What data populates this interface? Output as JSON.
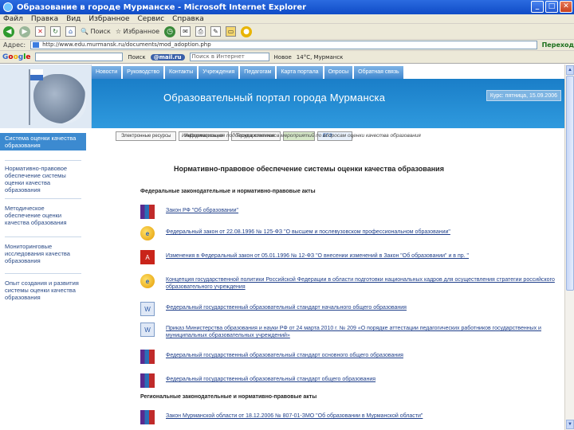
{
  "window": {
    "title": "Образование в городе Мурманске - Microsoft Internet Explorer",
    "buttons": [
      "_",
      "□",
      "✕"
    ]
  },
  "menubar": [
    "Файл",
    "Правка",
    "Вид",
    "Избранное",
    "Сервис",
    "Справка"
  ],
  "toolbar": {
    "back_label": "",
    "search_label": "Поиск",
    "favorites_label": "Избранное"
  },
  "address": {
    "label": "Адрес:",
    "value": "http://www.edu.murmansk.ru/documents/mod_adoption.php",
    "go_label": "Переход"
  },
  "googlebar": {
    "logo": [
      "G",
      "o",
      "o",
      "g",
      "l",
      "e"
    ],
    "go_label": "Поиск",
    "mail_label": "@mail.ru",
    "search_placeholder": "Поиск в Интернет",
    "news_label": "Новое",
    "weather_label": "14°C, Мурманск"
  },
  "nav_tabs": [
    "Новости",
    "Руководство",
    "Контакты",
    "Учреждения",
    "Педагогам",
    "Карта портала",
    "Опросы",
    "Обратная связь"
  ],
  "banner": {
    "title": "Образовательный портал города Мурманска",
    "badge": "Курс: пятница, 15.09.2006"
  },
  "subtabs": [
    "Электронные ресурсы",
    "Информатизация",
    "Государственная",
    "",
    "ЕГЭ"
  ],
  "info_line": "Информационная поддержка комплекса мероприятий по вопросам оценки качества образования",
  "sidebar": [
    "Система оценки качества образования",
    "Нормативно-правовое обеспечение системы оценки качества образования",
    "Методическое обеспечение оценки качества образования",
    "Мониторинговые исследования качества образования",
    "Опыт создания и развития системы оценки качества образования"
  ],
  "content": {
    "title": "Нормативно-правовое обеспечение системы оценки качества образования",
    "section_federal": "Федеральные законодательные и нормативно-правовые акты",
    "section_regional": "Региональные законодательные и нормативно-правовые акты",
    "documents": [
      {
        "icon": "rar",
        "text": "Закон РФ \"Об образовании\""
      },
      {
        "icon": "ie",
        "text": "Федеральный закон от 22.08.1996 № 125-ФЗ \"О высшем и послевузовском профессиональном образовании\""
      },
      {
        "icon": "pdf",
        "text": "Изменения в Федеральный закон от 05.01.1996 № 12-ФЗ \"О внесении изменений в Закон \"Об образовании\" и в пр. \""
      },
      {
        "icon": "ie",
        "text": "Концепция государственной политики Российской Федерации в области подготовки национальных кадров для осуществления стратегии российского образовательного учреждения"
      },
      {
        "icon": "doc",
        "text": "Федеральный государственный образовательный стандарт начального общего образования"
      },
      {
        "icon": "doc",
        "text": "Приказ Министерства образования и науки РФ от 24 марта 2010 г. № 209 «О порядке аттестации педагогических работников государственных и муниципальных образовательных учреждений»"
      },
      {
        "icon": "rar",
        "text": "Федеральный государственный образовательный стандарт основного общего образования"
      },
      {
        "icon": "rar",
        "text": "Федеральный государственный образовательный стандарт общего образования"
      },
      {
        "icon": "rar",
        "text": "Закон Мурманской области от 18.12.2006 № 807-01-ЗМО \"Об образовании в Мурманской области\""
      }
    ]
  },
  "colors": {
    "banner": "#2f9ade",
    "nav_tab": "#3f87cf",
    "sidebar_active": "#3c8ad0",
    "link": "#1f3f8a"
  }
}
